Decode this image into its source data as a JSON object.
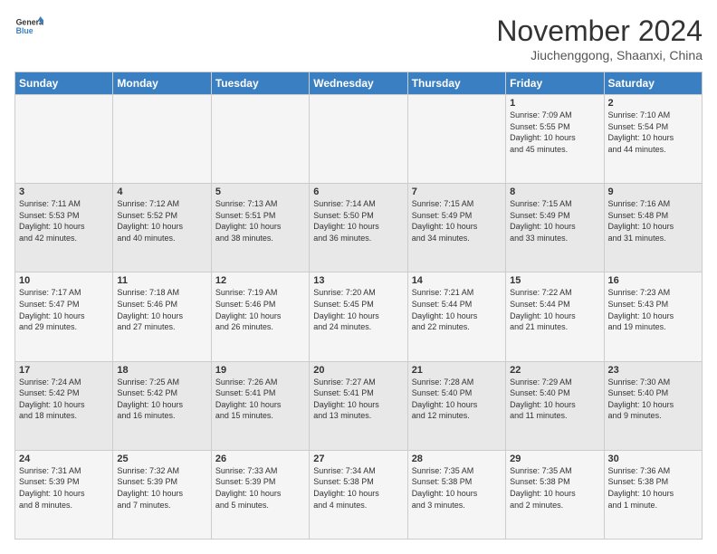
{
  "header": {
    "logo_line1": "General",
    "logo_line2": "Blue",
    "month": "November 2024",
    "location": "Jiuchenggong, Shaanxi, China"
  },
  "days_of_week": [
    "Sunday",
    "Monday",
    "Tuesday",
    "Wednesday",
    "Thursday",
    "Friday",
    "Saturday"
  ],
  "weeks": [
    [
      {
        "day": "",
        "info": ""
      },
      {
        "day": "",
        "info": ""
      },
      {
        "day": "",
        "info": ""
      },
      {
        "day": "",
        "info": ""
      },
      {
        "day": "",
        "info": ""
      },
      {
        "day": "1",
        "info": "Sunrise: 7:09 AM\nSunset: 5:55 PM\nDaylight: 10 hours\nand 45 minutes."
      },
      {
        "day": "2",
        "info": "Sunrise: 7:10 AM\nSunset: 5:54 PM\nDaylight: 10 hours\nand 44 minutes."
      }
    ],
    [
      {
        "day": "3",
        "info": "Sunrise: 7:11 AM\nSunset: 5:53 PM\nDaylight: 10 hours\nand 42 minutes."
      },
      {
        "day": "4",
        "info": "Sunrise: 7:12 AM\nSunset: 5:52 PM\nDaylight: 10 hours\nand 40 minutes."
      },
      {
        "day": "5",
        "info": "Sunrise: 7:13 AM\nSunset: 5:51 PM\nDaylight: 10 hours\nand 38 minutes."
      },
      {
        "day": "6",
        "info": "Sunrise: 7:14 AM\nSunset: 5:50 PM\nDaylight: 10 hours\nand 36 minutes."
      },
      {
        "day": "7",
        "info": "Sunrise: 7:15 AM\nSunset: 5:49 PM\nDaylight: 10 hours\nand 34 minutes."
      },
      {
        "day": "8",
        "info": "Sunrise: 7:15 AM\nSunset: 5:49 PM\nDaylight: 10 hours\nand 33 minutes."
      },
      {
        "day": "9",
        "info": "Sunrise: 7:16 AM\nSunset: 5:48 PM\nDaylight: 10 hours\nand 31 minutes."
      }
    ],
    [
      {
        "day": "10",
        "info": "Sunrise: 7:17 AM\nSunset: 5:47 PM\nDaylight: 10 hours\nand 29 minutes."
      },
      {
        "day": "11",
        "info": "Sunrise: 7:18 AM\nSunset: 5:46 PM\nDaylight: 10 hours\nand 27 minutes."
      },
      {
        "day": "12",
        "info": "Sunrise: 7:19 AM\nSunset: 5:46 PM\nDaylight: 10 hours\nand 26 minutes."
      },
      {
        "day": "13",
        "info": "Sunrise: 7:20 AM\nSunset: 5:45 PM\nDaylight: 10 hours\nand 24 minutes."
      },
      {
        "day": "14",
        "info": "Sunrise: 7:21 AM\nSunset: 5:44 PM\nDaylight: 10 hours\nand 22 minutes."
      },
      {
        "day": "15",
        "info": "Sunrise: 7:22 AM\nSunset: 5:44 PM\nDaylight: 10 hours\nand 21 minutes."
      },
      {
        "day": "16",
        "info": "Sunrise: 7:23 AM\nSunset: 5:43 PM\nDaylight: 10 hours\nand 19 minutes."
      }
    ],
    [
      {
        "day": "17",
        "info": "Sunrise: 7:24 AM\nSunset: 5:42 PM\nDaylight: 10 hours\nand 18 minutes."
      },
      {
        "day": "18",
        "info": "Sunrise: 7:25 AM\nSunset: 5:42 PM\nDaylight: 10 hours\nand 16 minutes."
      },
      {
        "day": "19",
        "info": "Sunrise: 7:26 AM\nSunset: 5:41 PM\nDaylight: 10 hours\nand 15 minutes."
      },
      {
        "day": "20",
        "info": "Sunrise: 7:27 AM\nSunset: 5:41 PM\nDaylight: 10 hours\nand 13 minutes."
      },
      {
        "day": "21",
        "info": "Sunrise: 7:28 AM\nSunset: 5:40 PM\nDaylight: 10 hours\nand 12 minutes."
      },
      {
        "day": "22",
        "info": "Sunrise: 7:29 AM\nSunset: 5:40 PM\nDaylight: 10 hours\nand 11 minutes."
      },
      {
        "day": "23",
        "info": "Sunrise: 7:30 AM\nSunset: 5:40 PM\nDaylight: 10 hours\nand 9 minutes."
      }
    ],
    [
      {
        "day": "24",
        "info": "Sunrise: 7:31 AM\nSunset: 5:39 PM\nDaylight: 10 hours\nand 8 minutes."
      },
      {
        "day": "25",
        "info": "Sunrise: 7:32 AM\nSunset: 5:39 PM\nDaylight: 10 hours\nand 7 minutes."
      },
      {
        "day": "26",
        "info": "Sunrise: 7:33 AM\nSunset: 5:39 PM\nDaylight: 10 hours\nand 5 minutes."
      },
      {
        "day": "27",
        "info": "Sunrise: 7:34 AM\nSunset: 5:38 PM\nDaylight: 10 hours\nand 4 minutes."
      },
      {
        "day": "28",
        "info": "Sunrise: 7:35 AM\nSunset: 5:38 PM\nDaylight: 10 hours\nand 3 minutes."
      },
      {
        "day": "29",
        "info": "Sunrise: 7:35 AM\nSunset: 5:38 PM\nDaylight: 10 hours\nand 2 minutes."
      },
      {
        "day": "30",
        "info": "Sunrise: 7:36 AM\nSunset: 5:38 PM\nDaylight: 10 hours\nand 1 minute."
      }
    ]
  ]
}
